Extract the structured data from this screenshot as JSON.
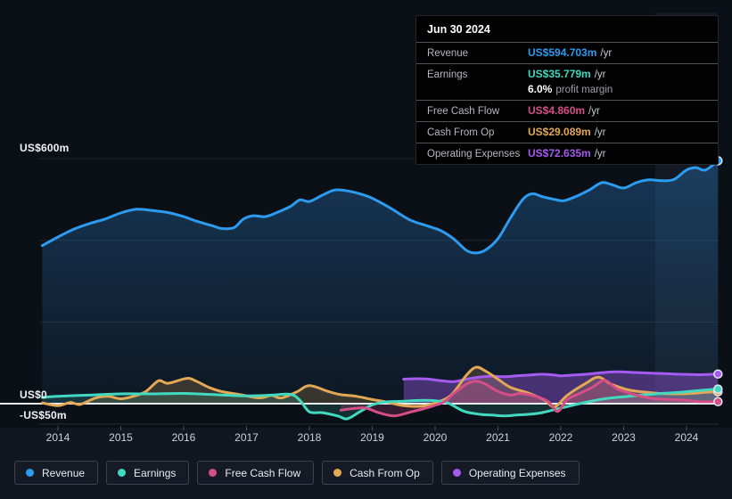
{
  "tooltip": {
    "date": "Jun 30 2024",
    "rows": [
      {
        "name": "revenue",
        "label": "Revenue",
        "value": "US$594.703m",
        "suffix": "/yr",
        "color": "#2d9bf0"
      },
      {
        "name": "earnings",
        "label": "Earnings",
        "value": "US$35.779m",
        "suffix": "/yr",
        "color": "#43d9c0",
        "sub_value": "6.0%",
        "sub_label": "profit margin"
      },
      {
        "name": "free-cash-flow",
        "label": "Free Cash Flow",
        "value": "US$4.860m",
        "suffix": "/yr",
        "color": "#d54e87"
      },
      {
        "name": "cash-from-op",
        "label": "Cash From Op",
        "value": "US$29.089m",
        "suffix": "/yr",
        "color": "#e2a855"
      },
      {
        "name": "operating-expenses",
        "label": "Operating Expenses",
        "value": "US$72.635m",
        "suffix": "/yr",
        "color": "#a55af0"
      }
    ]
  },
  "y_axis": {
    "labels": [
      {
        "text": "US$600m",
        "value": 600
      },
      {
        "text": "US$0",
        "value": 0
      },
      {
        "text": "-US$50m",
        "value": -50
      }
    ]
  },
  "x_axis": {
    "labels": [
      "2014",
      "2015",
      "2016",
      "2017",
      "2018",
      "2019",
      "2020",
      "2021",
      "2022",
      "2023",
      "2024"
    ]
  },
  "legend": [
    {
      "label": "Revenue",
      "color": "#2d9bf0"
    },
    {
      "label": "Earnings",
      "color": "#43d9c0"
    },
    {
      "label": "Free Cash Flow",
      "color": "#d54e87"
    },
    {
      "label": "Cash From Op",
      "color": "#e2a855"
    },
    {
      "label": "Operating Expenses",
      "color": "#a55af0"
    }
  ],
  "chart_data": {
    "type": "area",
    "unit": "US$ millions",
    "x_range": [
      2013.75,
      2024.5
    ],
    "ylim": [
      -80,
      960
    ],
    "y_gridline_values": [
      600,
      400,
      200,
      0,
      -50
    ],
    "highlight_band_x": [
      2023.5,
      2024.5
    ],
    "last_point_date": "Jun 30 2024",
    "series": [
      {
        "name": "Revenue",
        "color": "#2d9bf0",
        "points": [
          [
            2013.75,
            387
          ],
          [
            2014,
            408
          ],
          [
            2014.25,
            427
          ],
          [
            2014.5,
            441
          ],
          [
            2014.75,
            452
          ],
          [
            2015,
            467
          ],
          [
            2015.25,
            476
          ],
          [
            2015.5,
            473
          ],
          [
            2015.75,
            468
          ],
          [
            2016,
            458
          ],
          [
            2016.2,
            447
          ],
          [
            2016.45,
            436
          ],
          [
            2016.6,
            429
          ],
          [
            2016.8,
            431
          ],
          [
            2016.95,
            452
          ],
          [
            2017.1,
            460
          ],
          [
            2017.3,
            458
          ],
          [
            2017.5,
            469
          ],
          [
            2017.7,
            483
          ],
          [
            2017.85,
            499
          ],
          [
            2018.0,
            495
          ],
          [
            2018.2,
            510
          ],
          [
            2018.4,
            523
          ],
          [
            2018.6,
            521
          ],
          [
            2018.8,
            514
          ],
          [
            2019.0,
            503
          ],
          [
            2019.3,
            478
          ],
          [
            2019.6,
            450
          ],
          [
            2019.9,
            434
          ],
          [
            2020.1,
            423
          ],
          [
            2020.3,
            403
          ],
          [
            2020.5,
            375
          ],
          [
            2020.65,
            369
          ],
          [
            2020.8,
            376
          ],
          [
            2021.0,
            404
          ],
          [
            2021.2,
            455
          ],
          [
            2021.4,
            501
          ],
          [
            2021.55,
            514
          ],
          [
            2021.7,
            507
          ],
          [
            2021.9,
            500
          ],
          [
            2022.05,
            497
          ],
          [
            2022.25,
            508
          ],
          [
            2022.45,
            523
          ],
          [
            2022.65,
            541
          ],
          [
            2022.8,
            537
          ],
          [
            2023.0,
            528
          ],
          [
            2023.2,
            541
          ],
          [
            2023.4,
            548
          ],
          [
            2023.6,
            546
          ],
          [
            2023.8,
            549
          ],
          [
            2024.0,
            572
          ],
          [
            2024.15,
            578
          ],
          [
            2024.3,
            572
          ],
          [
            2024.5,
            594.7
          ]
        ]
      },
      {
        "name": "Operating Expenses",
        "color": "#a55af0",
        "points": [
          [
            2019.5,
            60
          ],
          [
            2019.7,
            61
          ],
          [
            2019.9,
            60
          ],
          [
            2020.1,
            56
          ],
          [
            2020.3,
            54
          ],
          [
            2020.5,
            60
          ],
          [
            2020.7,
            65
          ],
          [
            2020.9,
            67
          ],
          [
            2021.1,
            66
          ],
          [
            2021.3,
            68
          ],
          [
            2021.5,
            70
          ],
          [
            2021.7,
            72
          ],
          [
            2021.9,
            70
          ],
          [
            2022.0,
            68
          ],
          [
            2022.2,
            70
          ],
          [
            2022.4,
            72
          ],
          [
            2022.6,
            75
          ],
          [
            2022.85,
            78
          ],
          [
            2023.1,
            77
          ],
          [
            2023.4,
            75
          ],
          [
            2023.6,
            74
          ],
          [
            2023.9,
            72
          ],
          [
            2024.2,
            71
          ],
          [
            2024.5,
            72.6
          ]
        ]
      },
      {
        "name": "Cash From Op",
        "color": "#e2a855",
        "points": [
          [
            2013.75,
            2
          ],
          [
            2014.0,
            -5
          ],
          [
            2014.2,
            3
          ],
          [
            2014.35,
            -2
          ],
          [
            2014.6,
            14
          ],
          [
            2014.8,
            18
          ],
          [
            2015.0,
            12
          ],
          [
            2015.2,
            18
          ],
          [
            2015.4,
            30
          ],
          [
            2015.6,
            56
          ],
          [
            2015.75,
            50
          ],
          [
            2016.05,
            62
          ],
          [
            2016.2,
            55
          ],
          [
            2016.4,
            40
          ],
          [
            2016.6,
            30
          ],
          [
            2016.9,
            22
          ],
          [
            2017.2,
            14
          ],
          [
            2017.4,
            20
          ],
          [
            2017.55,
            14
          ],
          [
            2017.8,
            29
          ],
          [
            2018.0,
            44
          ],
          [
            2018.3,
            30
          ],
          [
            2018.5,
            22
          ],
          [
            2018.75,
            18
          ],
          [
            2019.0,
            10
          ],
          [
            2019.2,
            5
          ],
          [
            2019.5,
            -5
          ],
          [
            2019.8,
            -6
          ],
          [
            2020.0,
            2
          ],
          [
            2020.25,
            20
          ],
          [
            2020.5,
            70
          ],
          [
            2020.65,
            89
          ],
          [
            2020.8,
            80
          ],
          [
            2021.0,
            60
          ],
          [
            2021.2,
            40
          ],
          [
            2021.5,
            25
          ],
          [
            2021.75,
            8
          ],
          [
            2021.9,
            -8
          ],
          [
            2022.1,
            20
          ],
          [
            2022.4,
            50
          ],
          [
            2022.6,
            65
          ],
          [
            2022.8,
            48
          ],
          [
            2023.1,
            33
          ],
          [
            2023.5,
            26
          ],
          [
            2023.8,
            24
          ],
          [
            2024.1,
            25
          ],
          [
            2024.3,
            28
          ],
          [
            2024.5,
            29.1
          ]
        ]
      },
      {
        "name": "Earnings",
        "color": "#43d9c0",
        "points": [
          [
            2013.75,
            15
          ],
          [
            2014,
            18
          ],
          [
            2014.5,
            21
          ],
          [
            2015,
            24
          ],
          [
            2015.5,
            24
          ],
          [
            2016,
            25
          ],
          [
            2016.5,
            22
          ],
          [
            2017,
            19
          ],
          [
            2017.4,
            21
          ],
          [
            2017.7,
            23
          ],
          [
            2017.85,
            8
          ],
          [
            2018.0,
            -20
          ],
          [
            2018.2,
            -22
          ],
          [
            2018.45,
            -30
          ],
          [
            2018.6,
            -37
          ],
          [
            2018.8,
            -20
          ],
          [
            2019.0,
            -3
          ],
          [
            2019.2,
            4
          ],
          [
            2019.5,
            6
          ],
          [
            2019.8,
            8
          ],
          [
            2020.0,
            7
          ],
          [
            2020.2,
            2
          ],
          [
            2020.45,
            -18
          ],
          [
            2020.7,
            -26
          ],
          [
            2020.9,
            -28
          ],
          [
            2021.1,
            -30
          ],
          [
            2021.3,
            -28
          ],
          [
            2021.5,
            -26
          ],
          [
            2021.7,
            -22
          ],
          [
            2022.0,
            -11
          ],
          [
            2022.3,
            0
          ],
          [
            2022.65,
            11
          ],
          [
            2023.0,
            17
          ],
          [
            2023.3,
            21
          ],
          [
            2023.6,
            25
          ],
          [
            2023.9,
            28
          ],
          [
            2024.2,
            32
          ],
          [
            2024.5,
            35.8
          ]
        ]
      },
      {
        "name": "Free Cash Flow",
        "color": "#d54e87",
        "points": [
          [
            2018.5,
            -16
          ],
          [
            2018.7,
            -12
          ],
          [
            2018.9,
            -11
          ],
          [
            2019.1,
            -22
          ],
          [
            2019.35,
            -30
          ],
          [
            2019.6,
            -21
          ],
          [
            2019.8,
            -13
          ],
          [
            2020.0,
            -4
          ],
          [
            2020.15,
            5
          ],
          [
            2020.3,
            25
          ],
          [
            2020.5,
            48
          ],
          [
            2020.65,
            55
          ],
          [
            2020.8,
            48
          ],
          [
            2021.0,
            30
          ],
          [
            2021.2,
            21
          ],
          [
            2021.35,
            25
          ],
          [
            2021.6,
            18
          ],
          [
            2021.8,
            5
          ],
          [
            2021.95,
            -19
          ],
          [
            2022.1,
            10
          ],
          [
            2022.3,
            25
          ],
          [
            2022.5,
            40
          ],
          [
            2022.7,
            57
          ],
          [
            2022.9,
            36
          ],
          [
            2023.2,
            21
          ],
          [
            2023.5,
            12
          ],
          [
            2023.8,
            10
          ],
          [
            2024.0,
            8
          ],
          [
            2024.2,
            5
          ],
          [
            2024.5,
            4.9
          ]
        ]
      }
    ]
  }
}
